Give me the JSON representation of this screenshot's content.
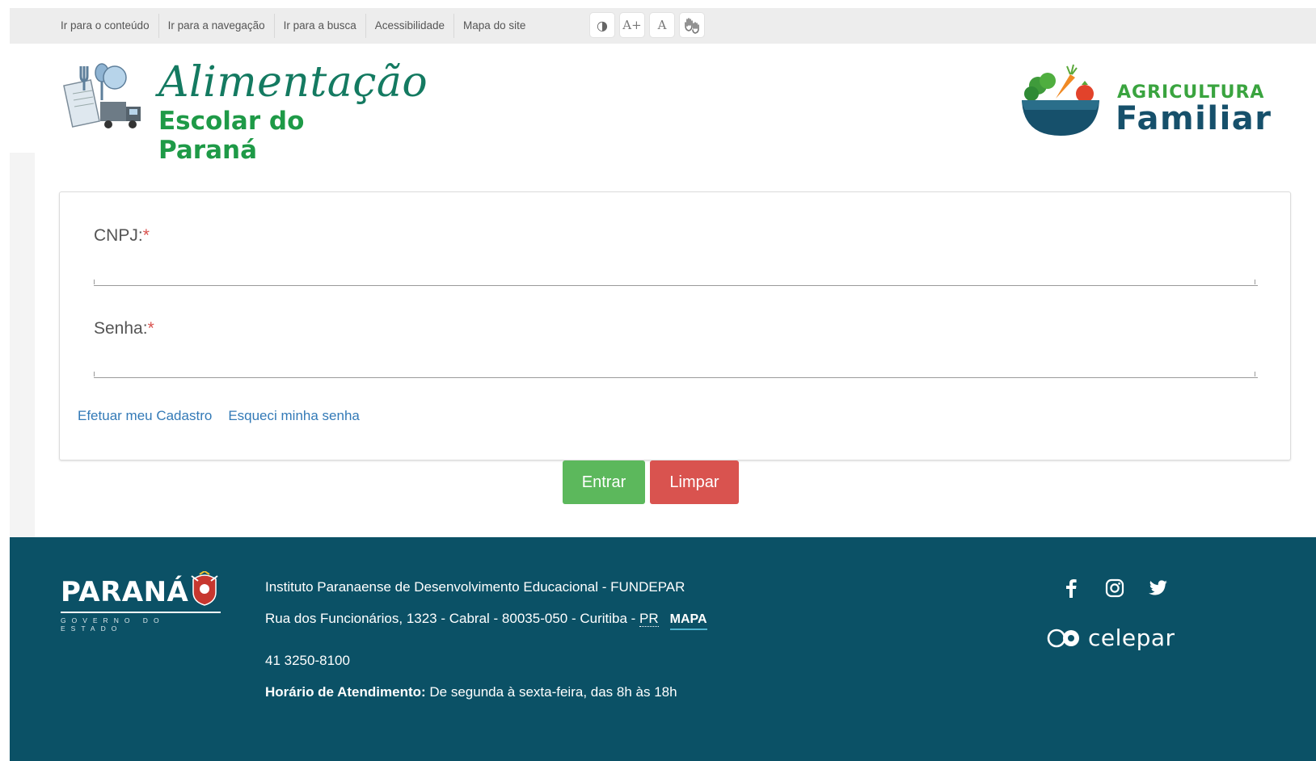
{
  "topbar": {
    "links": [
      "Ir para o conteúdo",
      "Ir para a navegação",
      "Ir para a busca",
      "Acessibilidade",
      "Mapa do site"
    ],
    "tools": {
      "contrast": "◑",
      "font_increase": "A+",
      "font_reset": "A",
      "libras": "libras-hands-icon"
    }
  },
  "header": {
    "logo_left_line1": "Alimentação",
    "logo_left_line2": "Escolar do Paraná",
    "logo_right_line1": "AGRICULTURA",
    "logo_right_line2": "Familiar"
  },
  "form": {
    "cnpj_label": "CNPJ:",
    "cnpj_value": "",
    "senha_label": "Senha:",
    "senha_value": "",
    "required_mark": "*",
    "link_register": "Efetuar meu Cadastro",
    "link_forgot": "Esqueci minha senha",
    "submit_label": "Entrar",
    "clear_label": "Limpar"
  },
  "footer": {
    "logo_word": "PARANÁ",
    "logo_sub": "GOVERNO DO ESTADO",
    "institute": "Instituto Paranaense de Desenvolvimento Educacional - FUNDEPAR",
    "address": "Rua dos Funcionários, 1323 - Cabral - 80035-050 - Curitiba - ",
    "state": "PR",
    "map_link": "MAPA",
    "phone": "41 3250-8100",
    "hours_label": "Horário de Atendimento:",
    "hours_value": " De segunda à sexta-feira, das 8h às 18h",
    "celepar": "celepar"
  },
  "colors": {
    "green_button": "#5cb85c",
    "red_button": "#d9534f",
    "footer_bg": "#0b5166",
    "link": "#337ab7"
  }
}
